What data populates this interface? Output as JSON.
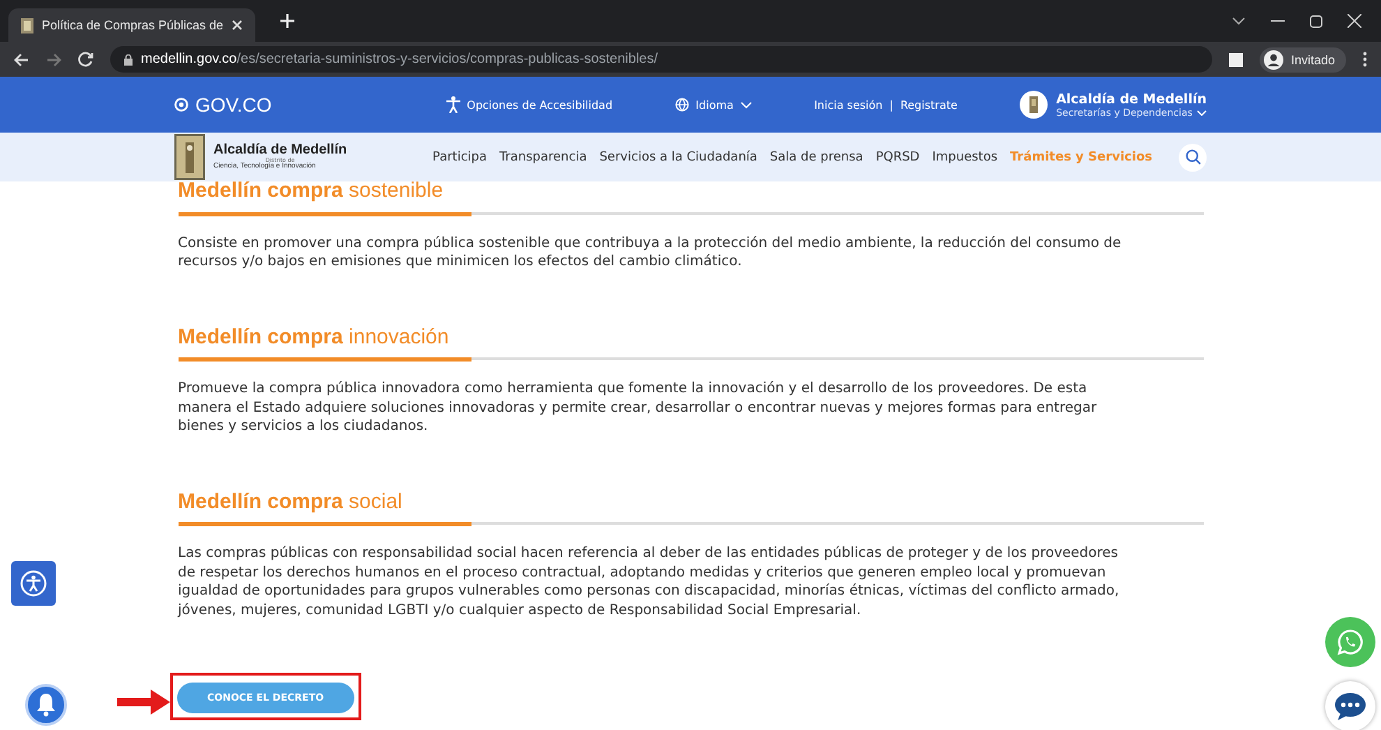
{
  "browser": {
    "tab_title": "Política de Compras Públicas de",
    "url_host": "medellin.gov.co",
    "url_path": "/es/secretaria-suministros-y-servicios/compras-publicas-sostenibles/",
    "profile": "Invitado"
  },
  "gov_bar": {
    "logo": "GOV.CO",
    "accessibility": "Opciones de Accesibilidad",
    "language": "Idioma",
    "login": "Inicia sesión",
    "separator": "|",
    "register": "Registrate",
    "org_name": "Alcaldía de Medellín",
    "org_sub": "Secretarías y Dependencias"
  },
  "nav": {
    "logo_title": "Alcaldía de Medellín",
    "logo_district": "Distrito de",
    "logo_sub": "Ciencia, Tecnología e Innovación",
    "items": [
      {
        "label": "Participa",
        "selected": false
      },
      {
        "label": "Transparencia",
        "selected": false
      },
      {
        "label": "Servicios a la Ciudadanía",
        "selected": false
      },
      {
        "label": "Sala de prensa",
        "selected": false
      },
      {
        "label": "PQRSD",
        "selected": false
      },
      {
        "label": "Impuestos",
        "selected": false
      },
      {
        "label": "Trámites y Servicios",
        "selected": true
      }
    ]
  },
  "sections": [
    {
      "title": "**Medellín compra** sostenible",
      "text": "Consiste en promover una compra pública sostenible que contribuya a la protección del medio ambiente, la reducción del consumo de recursos y/o bajos en emisiones que minimicen los efectos del cambio climático."
    },
    {
      "title": "**Medellín compra** innovación",
      "text": "Promueve la compra pública innovadora como herramienta que fomente la innovación y el desarrollo de los proveedores. De esta manera el Estado adquiere soluciones innovadoras y permite crear, desarrollar o encontrar nuevas y mejores formas para entregar bienes y servicios a los ciudadanos."
    },
    {
      "title": "**Medellín compra** social",
      "text": "Las compras públicas con responsabilidad social hacen referencia al deber de las entidades públicas de proteger y de los proveedores de respetar los derechos humanos en el proceso contractual, adoptando medidas y criterios que generen empleo local y promuevan igualdad de oportunidades para grupos vulnerables como personas con discapacidad, minorías étnicas, víctimas del conflicto armado, jóvenes, mujeres, comunidad LGBTI y/o cualquier aspecto de Responsabilidad Social Empresarial."
    }
  ],
  "cta_button": "CONOCE EL DECRETO"
}
